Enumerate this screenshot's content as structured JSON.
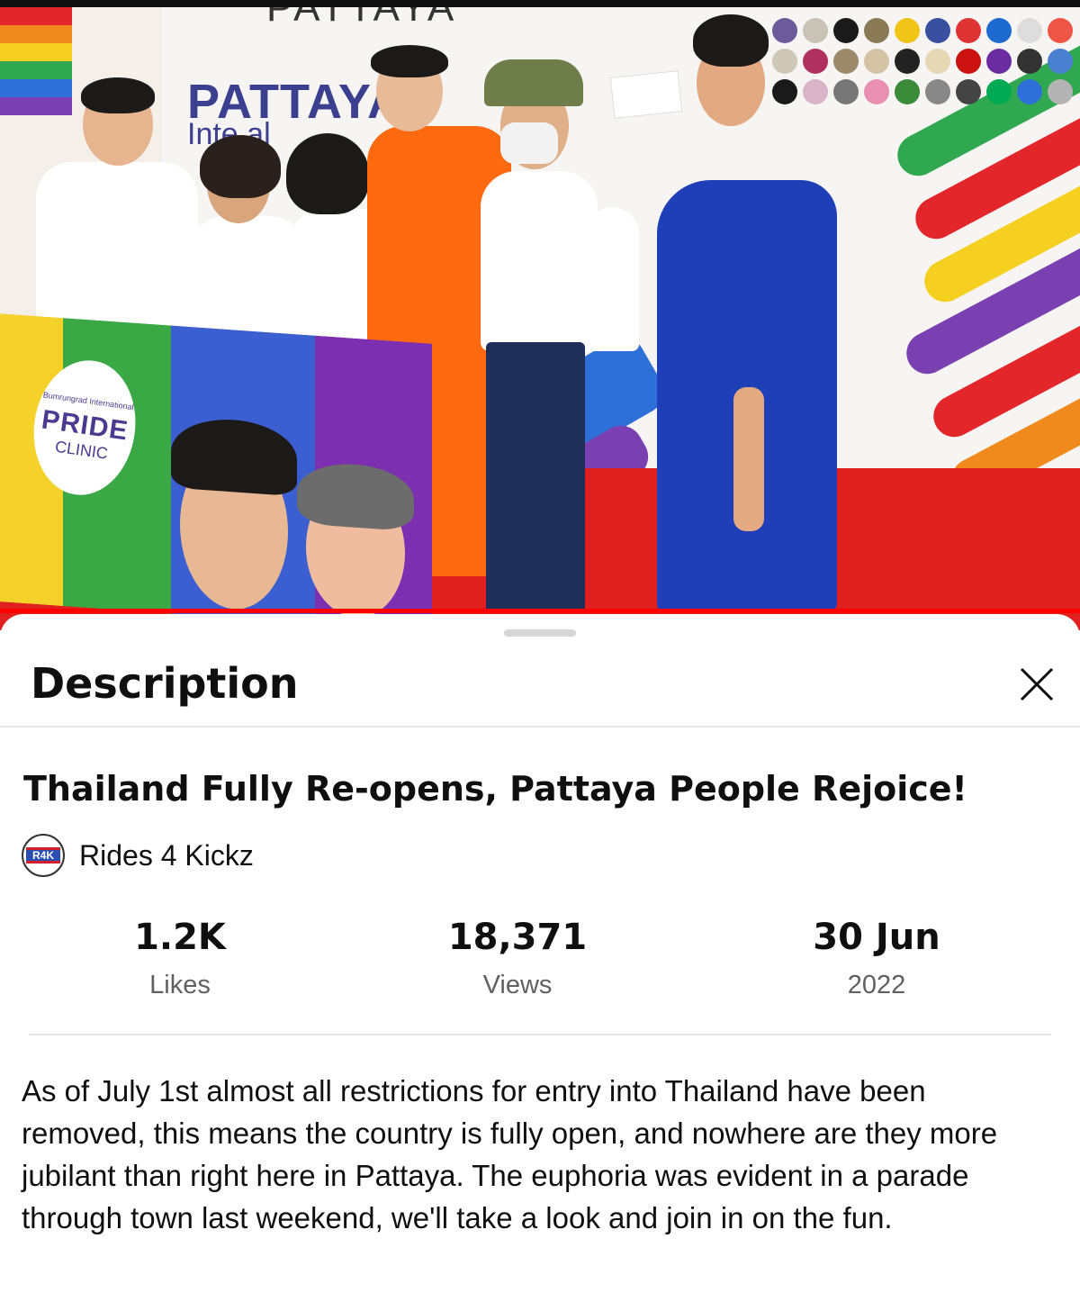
{
  "video": {
    "event_top_word": "PATTAYA",
    "event_title": "PATTAYA",
    "event_subtitle": "Inte        al",
    "banner_pride": "PRIDE",
    "banner_clinic": "CLINIC",
    "banner_hospital": "Bumrungrad International",
    "progress": 1.0,
    "progress_color": "#ff0000"
  },
  "sheet": {
    "title": "Description",
    "close_icon": "close-icon"
  },
  "video_info": {
    "title": "Thailand Fully Re-opens, Pattaya People Rejoice!",
    "channel": {
      "name": "Rides 4 Kickz",
      "avatar_text": "R4K"
    }
  },
  "stats": [
    {
      "value": "1.2K",
      "label": "Likes"
    },
    {
      "value": "18,371",
      "label": "Views"
    },
    {
      "value": "30 Jun",
      "label": "2022"
    }
  ],
  "description": "As of July 1st almost all restrictions for entry into Thailand have been removed, this means the country is fully open, and nowhere are they more jubilant than right here in Pattaya.  The euphoria was evident in a parade through town last weekend, we'll take a look and join in on the fun.",
  "colors": {
    "text_primary": "#0f0f0f",
    "text_secondary": "#606060",
    "divider": "#e5e5e5",
    "carpet": "#e0201e",
    "dress": "#1f3fb8",
    "orange_suit": "#ff6a10"
  }
}
